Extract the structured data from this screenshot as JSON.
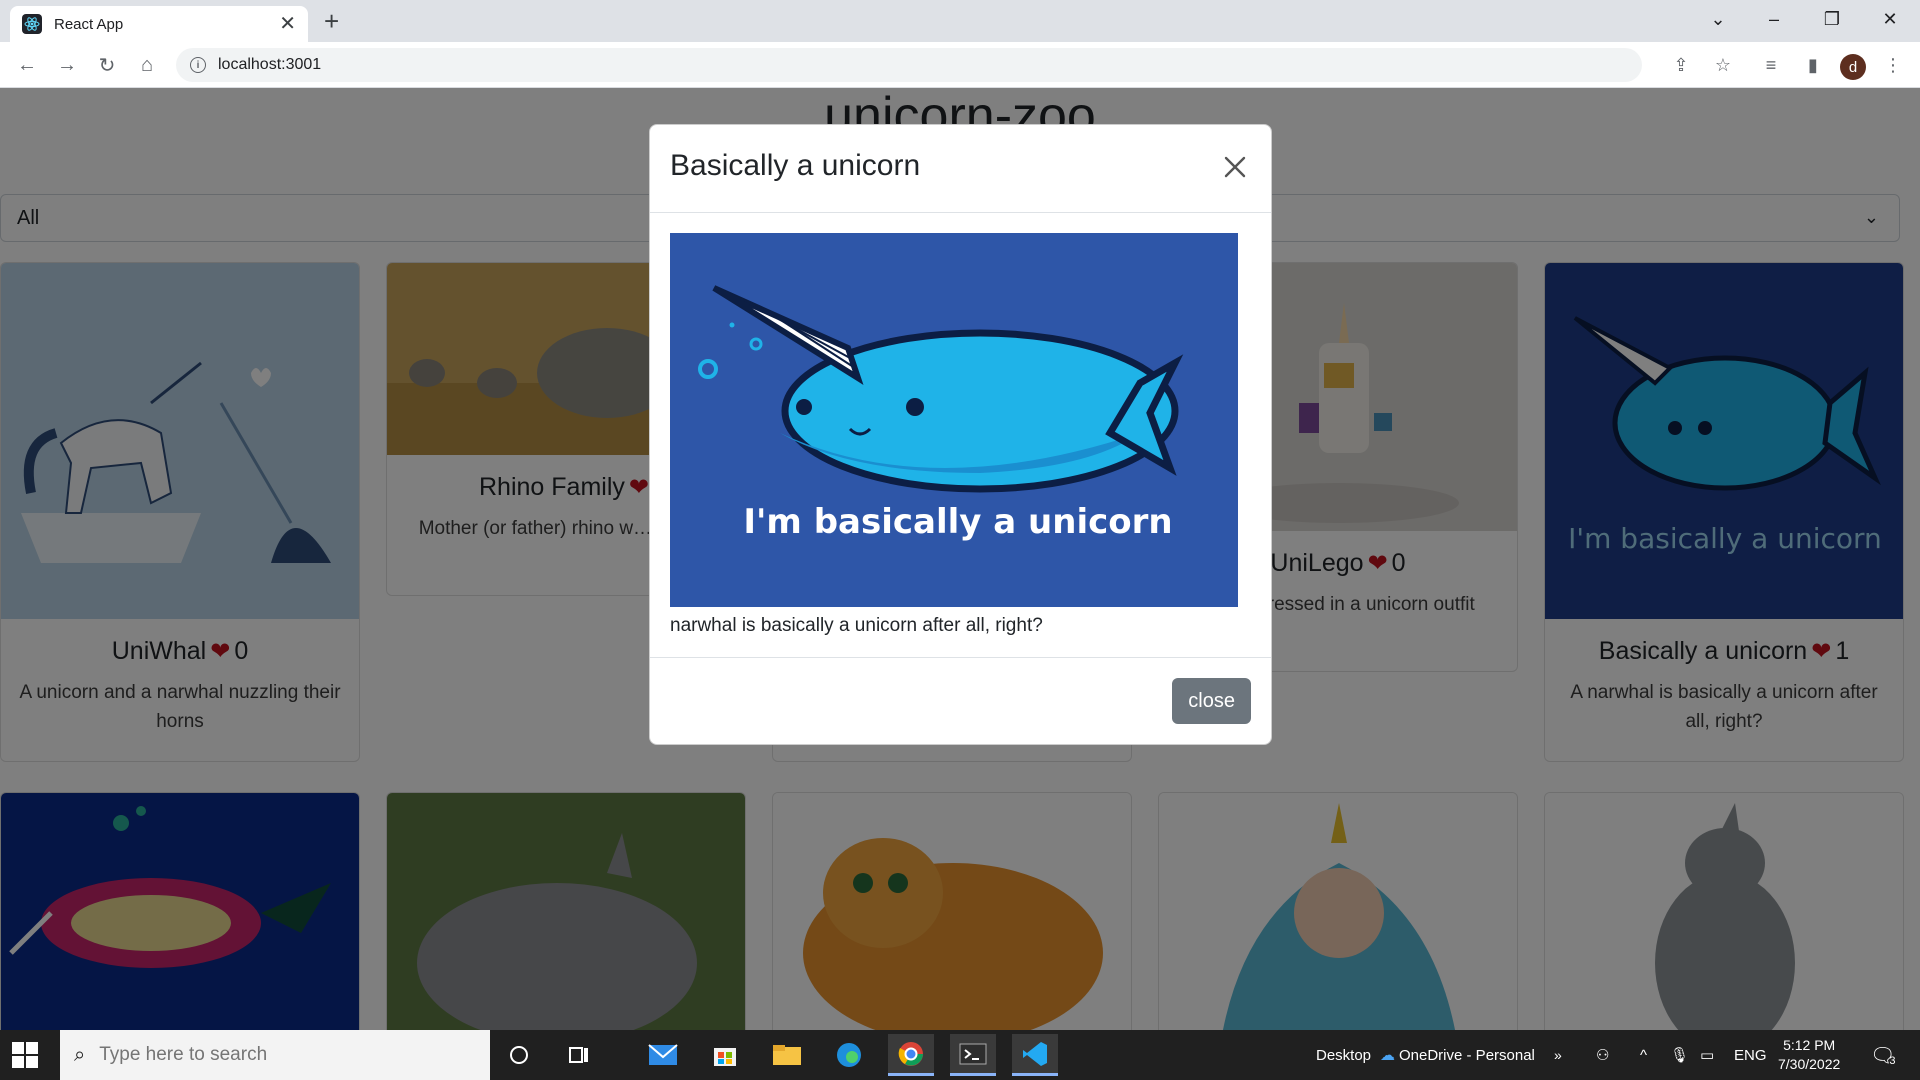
{
  "browser": {
    "tab_title": "React App",
    "url": "localhost:3001",
    "profile_initial": "d"
  },
  "page": {
    "title": "unicorn-zoo",
    "filter_value": "All"
  },
  "cards": [
    {
      "name": "UniWhal",
      "likes": "0",
      "description": "A unicorn and a narwhal nuzzling their horns"
    },
    {
      "name": "Rhino Family",
      "likes": "",
      "description": "Mother (or father) rhino w… babies"
    },
    {
      "name": "UniLego",
      "likes": "0",
      "description": "…rine dressed in a unicorn outfit"
    },
    {
      "name": "Basically a unicorn",
      "likes": "1",
      "description": "A narwhal is basically a unicorn after all, right?"
    }
  ],
  "modal": {
    "title": "Basically a unicorn",
    "image_text": "I'm basically a unicorn",
    "caption": "narwhal is basically a unicorn after all, right?",
    "close_label": "close"
  },
  "taskbar": {
    "search_placeholder": "Type here to search",
    "desktop_label": "Desktop",
    "onedrive_label": "OneDrive - Personal",
    "language": "ENG",
    "time": "5:12 PM",
    "date": "7/30/2022",
    "notification_count": "3"
  },
  "colors": {
    "modal_image_bg": "#2e56a8",
    "narwhal_body": "#1fb3e8",
    "heart": "#c1121f",
    "close_button": "#6c757d"
  }
}
